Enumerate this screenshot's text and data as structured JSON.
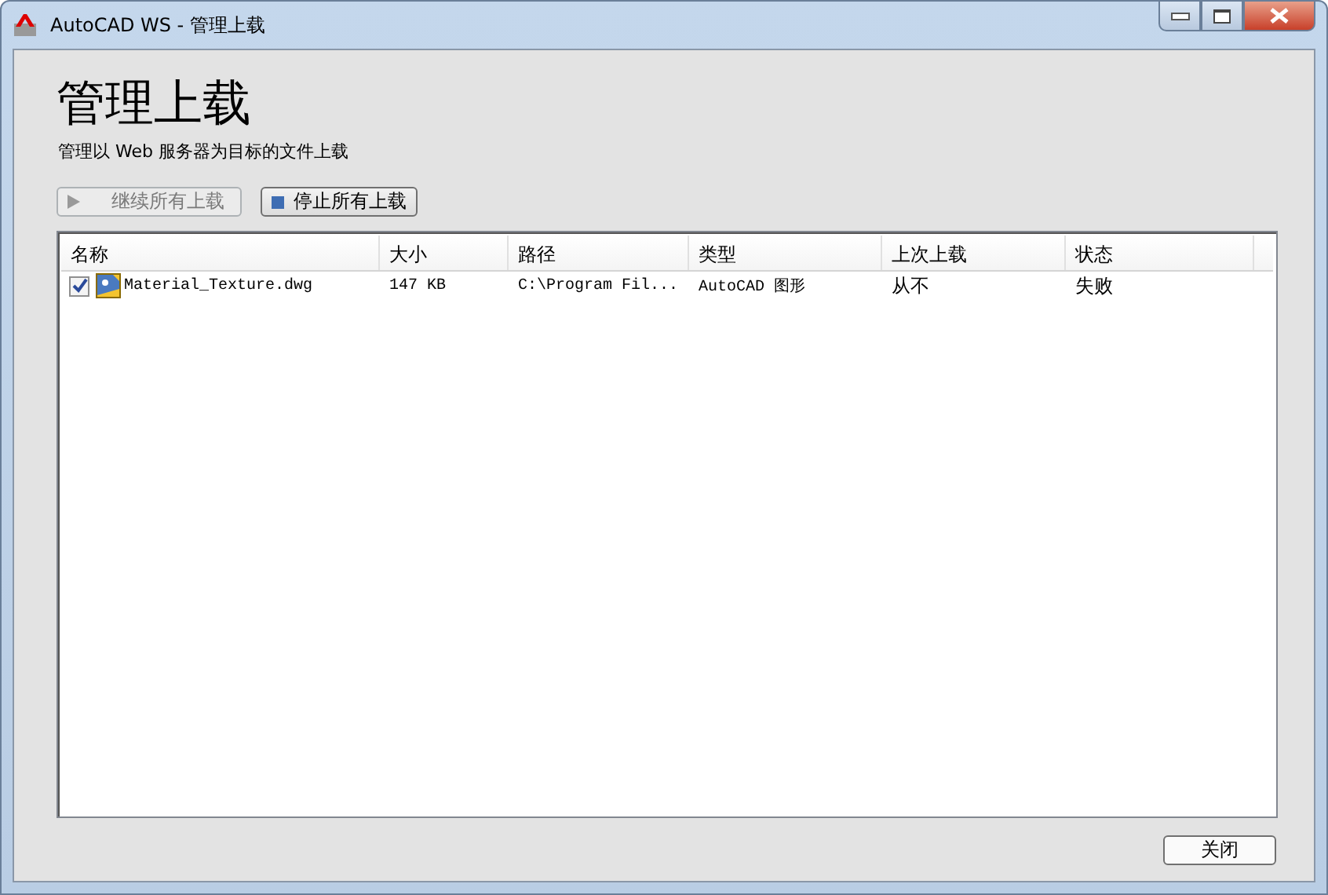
{
  "window": {
    "title": "AutoCAD WS - 管理上载"
  },
  "heading": "管理上载",
  "subtitle": "管理以 Web 服务器为目标的文件上载",
  "toolbar": [
    {
      "label": "继续所有上载",
      "kind": "play",
      "disabled": true
    },
    {
      "label": "停止所有上载",
      "kind": "stop",
      "disabled": false
    }
  ],
  "table": {
    "columns": [
      "名称",
      "大小",
      "路径",
      "类型",
      "上次上载",
      "状态"
    ],
    "rows": [
      {
        "checked": true,
        "cells": [
          "Material_Texture.dwg",
          "147 KB",
          "C:\\Program Fil...",
          "AutoCAD 图形",
          "从不",
          "失败"
        ]
      }
    ]
  },
  "close_button": "关闭"
}
